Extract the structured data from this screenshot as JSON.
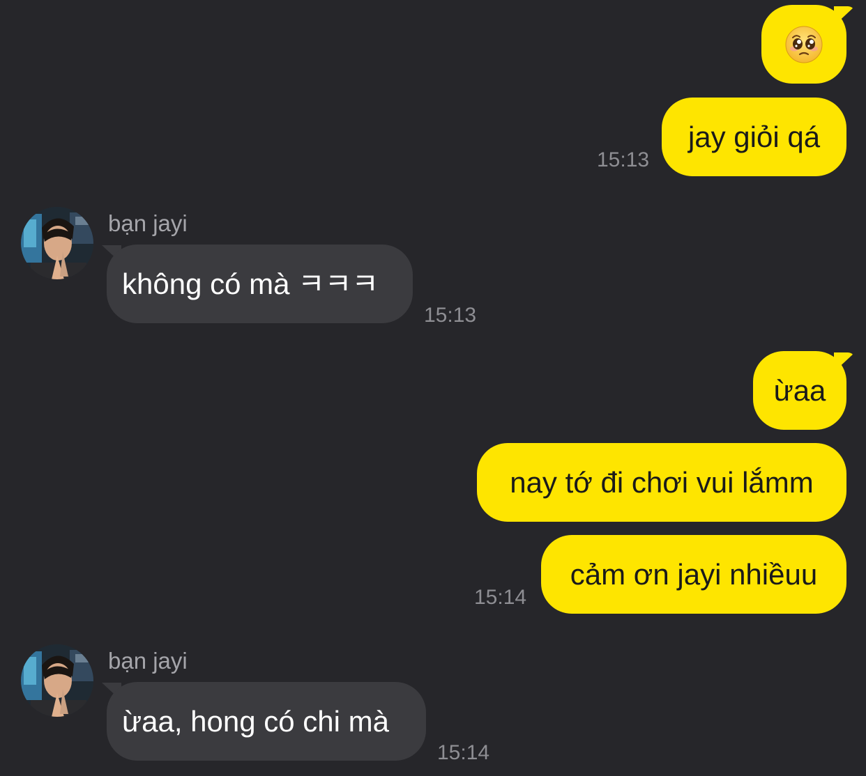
{
  "messages": [
    {
      "side": "out",
      "text": "",
      "emoji": "pleading-face"
    },
    {
      "side": "out",
      "text": "jay giỏi qá",
      "time": "15:13"
    },
    {
      "side": "in",
      "sender": "bạn jayi",
      "text": "không có mà ㅋㅋㅋ",
      "time": "15:13"
    },
    {
      "side": "out",
      "text": "ừaa"
    },
    {
      "side": "out",
      "text": "nay tớ đi chơi vui lắmm"
    },
    {
      "side": "out",
      "text": "cảm ơn jayi nhiềuu",
      "time": "15:14"
    },
    {
      "side": "in",
      "sender": "bạn jayi",
      "text": "ừaa, hong có chi mà",
      "time": "15:14"
    }
  ],
  "colors": {
    "background": "#26262a",
    "outgoing_bubble": "#fee500",
    "incoming_bubble": "#3b3b3f",
    "timestamp": "#8e8e93",
    "sender_name": "#a5a5aa"
  }
}
